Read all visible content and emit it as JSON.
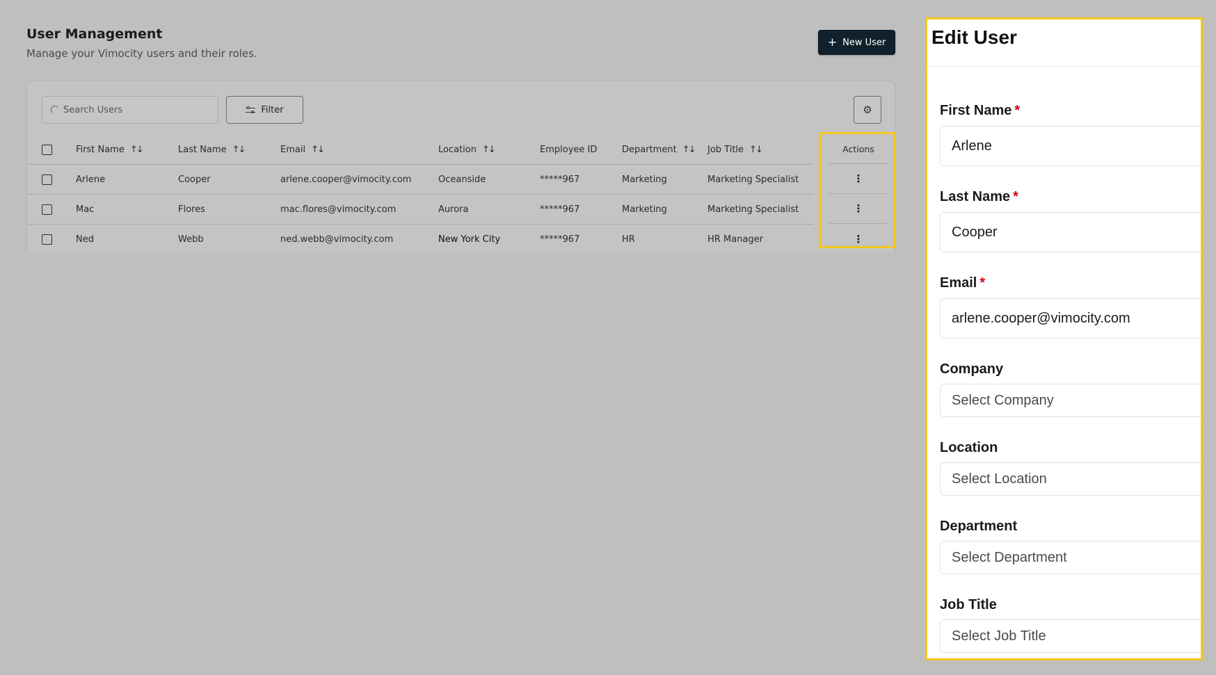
{
  "header": {
    "title": "User Management",
    "subtitle": "Manage your Vimocity users and their roles.",
    "new_user_label": "New User",
    "new_user_icon": "plus-icon"
  },
  "toolbar": {
    "search_placeholder": "Search Users",
    "filter_label": "Filter",
    "settings_icon": "gear-icon"
  },
  "table": {
    "columns": [
      "First Name",
      "Last Name",
      "Email",
      "Location",
      "Employee ID",
      "Department",
      "Job Title",
      "Actions"
    ],
    "sortable": [
      true,
      true,
      true,
      true,
      false,
      true,
      true,
      false
    ],
    "rows": [
      {
        "first": "Arlene",
        "last": "Cooper",
        "email": "arlene.cooper@vimocity.com",
        "location": "Oceanside",
        "employee_id": "*****967",
        "department": "Marketing",
        "job_title": "Marketing Specialist"
      },
      {
        "first": "Mac",
        "last": "Flores",
        "email": "mac.flores@vimocity.com",
        "location": "Aurora",
        "employee_id": "*****967",
        "department": "Marketing",
        "job_title": "Marketing Specialist"
      },
      {
        "first": "Ned",
        "last": "Webb",
        "email": "ned.webb@vimocity.com",
        "location": "New York City",
        "employee_id": "*****967",
        "department": "HR",
        "job_title": "HR Manager"
      }
    ],
    "action_icon": "kebab-menu-icon"
  },
  "edit_user": {
    "title": "Edit User",
    "first_name_label": "First Name",
    "first_name_value": "Arlene",
    "last_name_label": "Last Name",
    "last_name_value": "Cooper",
    "email_label": "Email",
    "email_value": "arlene.cooper@vimocity.com",
    "required_mark": "*",
    "company_label": "Company",
    "company_placeholder": "Select Company",
    "location_label": "Location",
    "location_placeholder": "Select Location",
    "department_label": "Department",
    "department_placeholder": "Select Department",
    "job_title_label": "Job Title",
    "job_title_placeholder": "Select Job Title"
  },
  "colors": {
    "highlight": "#f3c81a",
    "primary_button": "#10212c",
    "required": "#d0021b",
    "backdrop": "#bfbfbf"
  }
}
